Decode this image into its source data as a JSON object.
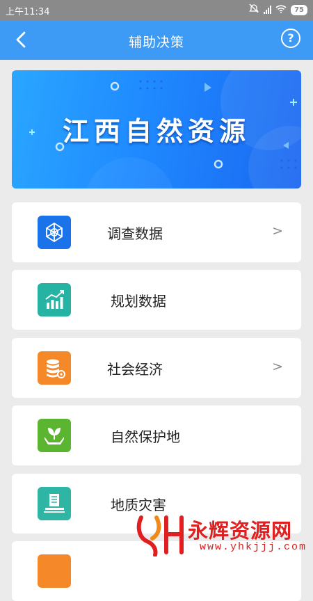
{
  "status_bar": {
    "time": "上午11:34",
    "battery": "75"
  },
  "header": {
    "title": "辅助决策",
    "help_label": "?"
  },
  "banner": {
    "title": "江西自然资源"
  },
  "menu": {
    "items": [
      {
        "label": "调查数据",
        "arrow": ">",
        "icon": "network-globe-icon",
        "color": "#1a73e8"
      },
      {
        "label": "规划数据",
        "arrow": "",
        "icon": "bar-chart-trend-icon",
        "color": "#27b3a3"
      },
      {
        "label": "社会经济",
        "arrow": ">",
        "icon": "database-gear-icon",
        "color": "#f5892a"
      },
      {
        "label": "自然保护地",
        "arrow": "",
        "icon": "plant-hands-icon",
        "color": "#5cb531"
      },
      {
        "label": "地质灾害",
        "arrow": "",
        "icon": "survey-building-icon",
        "color": "#2fb5a3"
      }
    ]
  },
  "watermark": {
    "text": "永辉资源网",
    "url": "www.yhkjjj.com"
  }
}
